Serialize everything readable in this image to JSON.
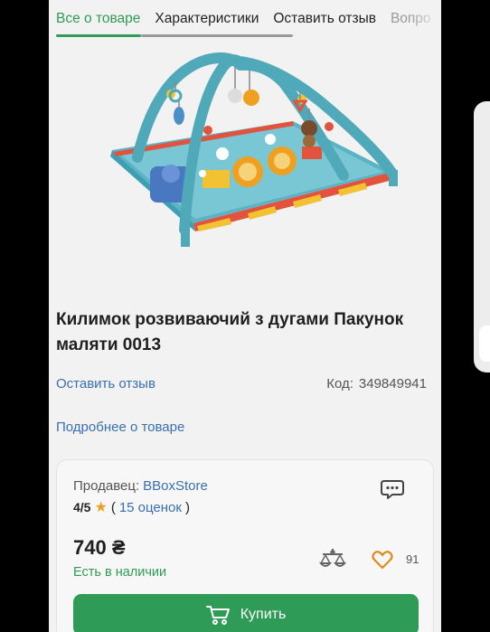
{
  "tabs": [
    {
      "label": "Все о товаре",
      "active": true
    },
    {
      "label": "Характеристики"
    },
    {
      "label": "Оставить отзыв"
    },
    {
      "label": "Вопро"
    }
  ],
  "product": {
    "title": "Килимок розвиваючий з дугами Пакунок маляти 0013",
    "review_link": "Оставить отзыв",
    "code_label": "Код:",
    "code_value": "349849941",
    "more_link": "Подробнее о товаре"
  },
  "seller": {
    "label": "Продавец:",
    "name": "BBoxStore",
    "rating": "4/5",
    "reviews_open": "(",
    "reviews_text": "15 оценок",
    "reviews_close": ")"
  },
  "offer": {
    "price": "740 ₴",
    "availability": "Есть в наличии",
    "favorites_count": "91",
    "buy_label": "Купить"
  },
  "icons": {
    "chat": "chat-bubble-icon",
    "compare": "compare-scales-icon",
    "favorite": "heart-icon",
    "cart": "cart-icon",
    "rating_star": "star-icon"
  },
  "colors": {
    "accent_green": "#2e9b56",
    "link_blue": "#3a6fb0",
    "heart_orange": "#e08a1a",
    "star": "#f0a020"
  }
}
